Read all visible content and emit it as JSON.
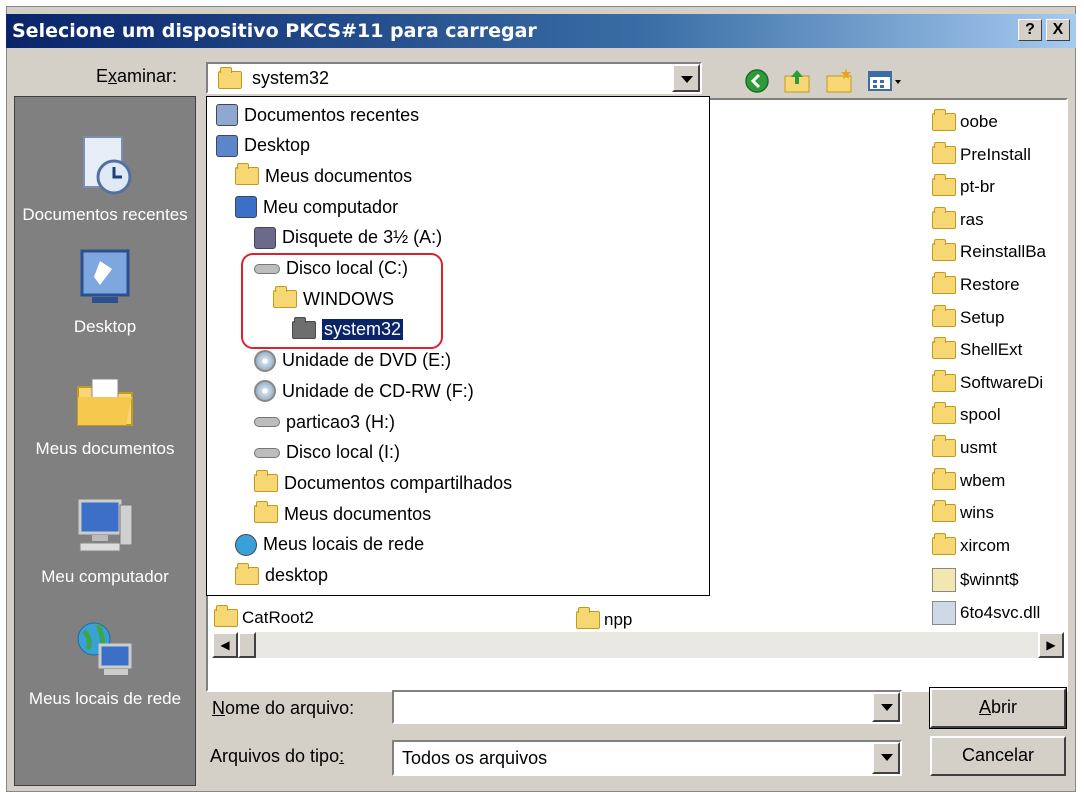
{
  "window": {
    "title": "Selecione um dispositivo PKCS#11 para carregar",
    "help_button": "?",
    "close_button": "X"
  },
  "toolbar": {
    "look_in_label": "Examinar:",
    "look_in_value": "system32",
    "icons": [
      "back-icon",
      "up-folder-icon",
      "new-folder-icon",
      "view-menu-icon"
    ]
  },
  "places": [
    {
      "label": "Documentos recentes",
      "icon": "recent-documents-icon"
    },
    {
      "label": "Desktop",
      "icon": "desktop-icon"
    },
    {
      "label": "Meus documentos",
      "icon": "my-documents-icon"
    },
    {
      "label": "Meu computador",
      "icon": "my-computer-icon"
    },
    {
      "label": "Meus locais de rede",
      "icon": "network-places-icon"
    }
  ],
  "dropdown_items": [
    {
      "label": "Documentos recentes",
      "icon": "recent-documents-icon",
      "level": 0
    },
    {
      "label": "Desktop",
      "icon": "desktop-icon",
      "level": 0
    },
    {
      "label": "Meus documentos",
      "icon": "folder-icon",
      "level": 1
    },
    {
      "label": "Meu computador",
      "icon": "computer-icon",
      "level": 1
    },
    {
      "label": "Disquete de 3½ (A:)",
      "icon": "floppy-icon",
      "level": 2
    },
    {
      "label": "Disco local (C:)",
      "icon": "drive-icon",
      "level": 2
    },
    {
      "label": "WINDOWS",
      "icon": "folder-icon",
      "level": 3
    },
    {
      "label": "system32",
      "icon": "folder-icon",
      "level": 4,
      "selected": true
    },
    {
      "label": "Unidade de DVD (E:)",
      "icon": "cd-icon",
      "level": 2
    },
    {
      "label": "Unidade de CD-RW (F:)",
      "icon": "cd-icon",
      "level": 2
    },
    {
      "label": "particao3 (H:)",
      "icon": "drive-icon",
      "level": 2
    },
    {
      "label": "Disco local (I:)",
      "icon": "drive-icon",
      "level": 2
    },
    {
      "label": "Documentos compartilhados",
      "icon": "folder-icon",
      "level": 2
    },
    {
      "label": "Meus documentos",
      "icon": "folder-icon",
      "level": 2
    },
    {
      "label": "Meus locais de rede",
      "icon": "network-icon",
      "level": 1
    },
    {
      "label": "desktop",
      "icon": "folder-icon",
      "level": 1
    }
  ],
  "files_right": [
    "oobe",
    "PreInstall",
    "pt-br",
    "ras",
    "ReinstallBa",
    "Restore",
    "Setup",
    "ShellExt",
    "SoftwareDi",
    "spool",
    "usmt",
    "wbem",
    "wins",
    "xircom",
    "$winnt$",
    "6to4svc.dll"
  ],
  "files_bottom": [
    "CatRoot2",
    "npp"
  ],
  "filename": {
    "label": "Nome do arquivo:",
    "value": ""
  },
  "filetype": {
    "label": "Arquivos do tipo:",
    "value": "Todos os arquivos"
  },
  "buttons": {
    "open": "Abrir",
    "cancel": "Cancelar"
  }
}
